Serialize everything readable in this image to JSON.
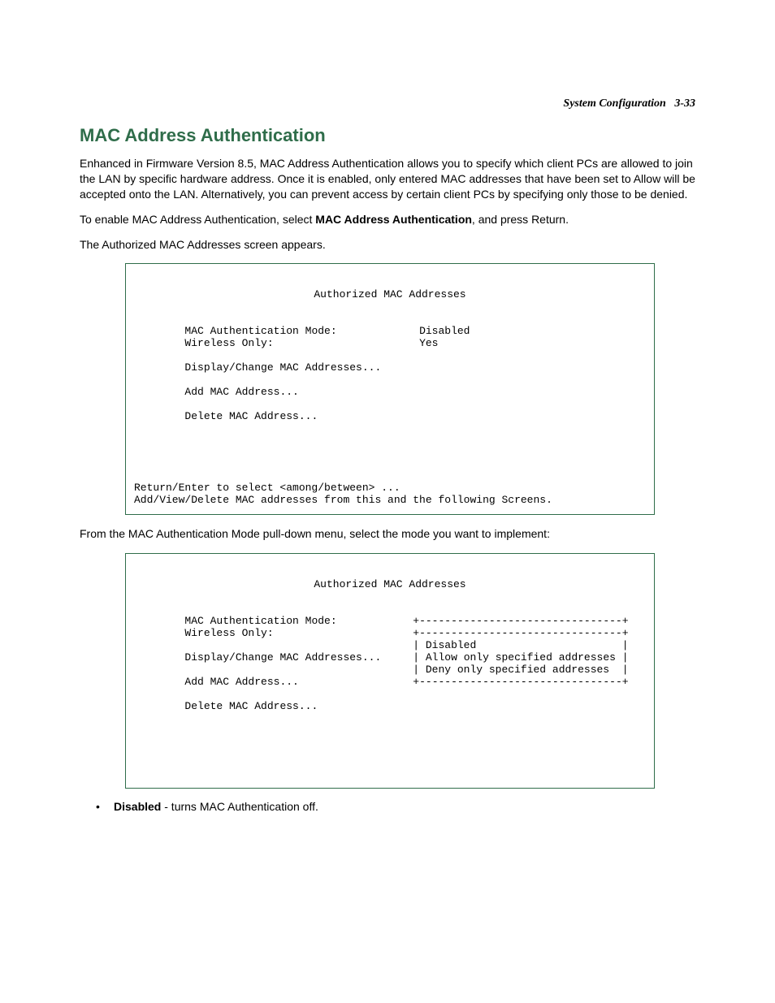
{
  "header": {
    "section": "System Configuration",
    "page": "3-33"
  },
  "title": "MAC Address Authentication",
  "paras": {
    "intro": "Enhanced in Firmware Version 8.5, MAC Address Authentication allows you to specify which client PCs are allowed to join the LAN by specific hardware address. Once it is enabled, only entered MAC addresses that have been set to Allow will be accepted onto the LAN. Alternatively, you can prevent access by certain client PCs by specifying only those to be denied.",
    "enable_pre": "To enable MAC Address Authentication, select ",
    "enable_bold": "MAC Address Authentication",
    "enable_post": ", and press Return.",
    "appears": "The Authorized MAC Addresses screen appears.",
    "pulldown": "From the MAC Authentication Mode pull-down menu, select the mode you want to implement:"
  },
  "term1": {
    "title": "Authorized MAC Addresses",
    "rows": {
      "mode_label": "MAC Authentication Mode:",
      "mode_value": "Disabled",
      "wireless_label": "Wireless Only:",
      "wireless_value": "Yes",
      "display": "Display/Change MAC Addresses...",
      "add": "Add MAC Address...",
      "delete": "Delete MAC Address..."
    },
    "footer1": "Return/Enter to select <among/between> ...",
    "footer2": "Add/View/Delete MAC addresses from this and the following Screens."
  },
  "term2": {
    "title": "Authorized MAC Addresses",
    "rows": {
      "mode_label": "MAC Authentication Mode:",
      "wireless_label": "Wireless Only:",
      "display": "Display/Change MAC Addresses...",
      "add": "Add MAC Address...",
      "delete": "Delete MAC Address..."
    },
    "menu": {
      "border": "+--------------------------------+",
      "opt1": "| Disabled                       |",
      "opt2": "| Allow only specified addresses |",
      "opt3": "| Deny only specified addresses  |"
    }
  },
  "bullet": {
    "term": "Disabled",
    "text": " - turns MAC Authentication off."
  }
}
